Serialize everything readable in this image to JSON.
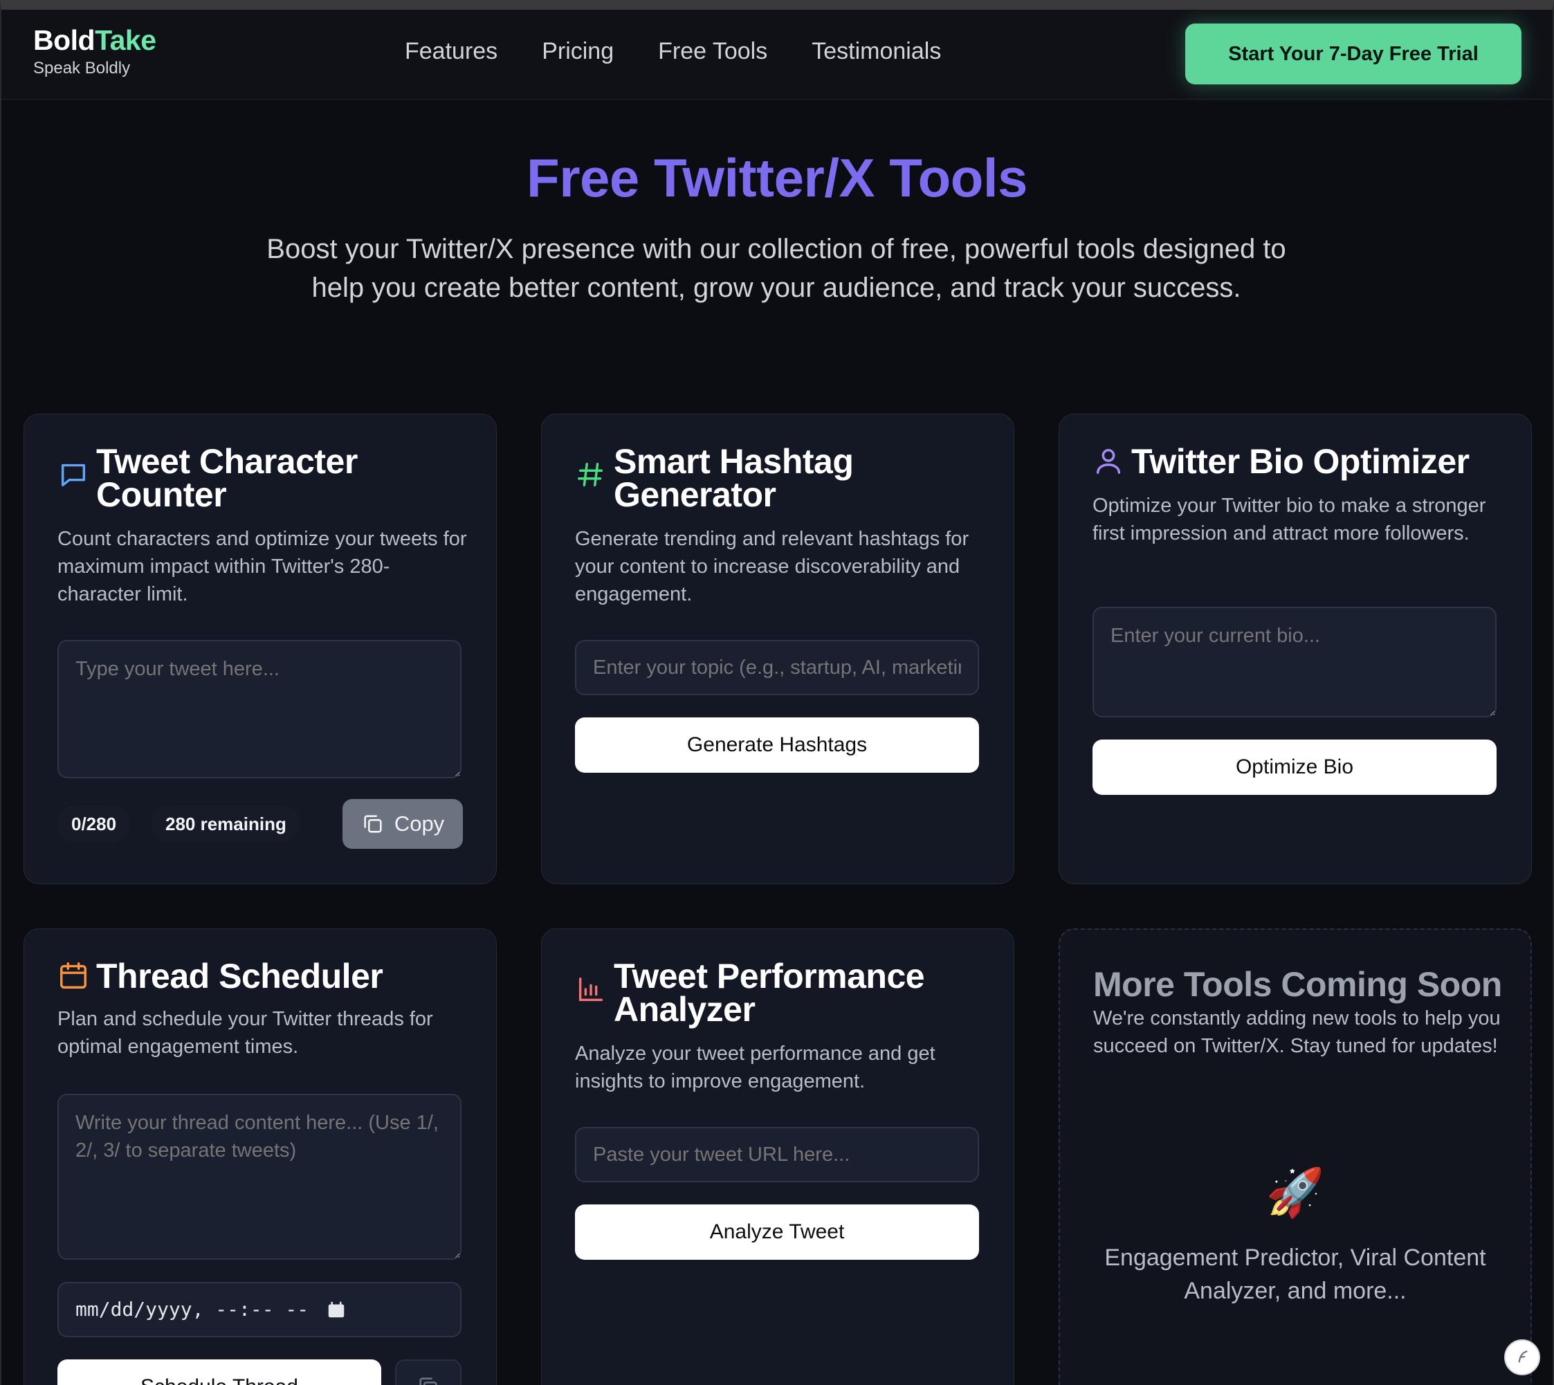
{
  "brand": {
    "name_part1": "Bold",
    "name_part2": "Take",
    "tagline": "Speak Boldly"
  },
  "nav": {
    "links": [
      "Features",
      "Pricing",
      "Free Tools",
      "Testimonials"
    ],
    "cta_label": "Start Your 7-Day Free Trial"
  },
  "hero": {
    "title": "Free Twitter/X Tools",
    "subtitle": "Boost your Twitter/X presence with our collection of free, powerful tools designed to help you create better content, grow your audience, and track your success."
  },
  "colors": {
    "accent_green": "#5fd699",
    "accent_purple": "#7c6cf0",
    "icon_blue": "#60a5fa",
    "icon_green": "#4ade80",
    "icon_violet": "#a78bfa",
    "icon_orange": "#fb923c",
    "icon_red": "#f87171",
    "card_bg": "#141824",
    "page_bg": "#0b0d13"
  },
  "tools": {
    "char_counter": {
      "icon": "message-icon",
      "title": "Tweet Character Counter",
      "description": "Count characters and optimize your tweets for maximum impact within Twitter's 280-character limit.",
      "placeholder": "Type your tweet here...",
      "count": "0/280",
      "remaining": "280 remaining",
      "copy_label": "Copy"
    },
    "hashtag": {
      "icon": "hash-icon",
      "title": "Smart Hashtag Generator",
      "description": "Generate trending and relevant hashtags for your content to increase discoverability and engagement.",
      "placeholder": "Enter your topic (e.g., startup, AI, marketing)",
      "button_label": "Generate Hashtags"
    },
    "bio": {
      "icon": "user-icon",
      "title": "Twitter Bio Optimizer",
      "description": "Optimize your Twitter bio to make a stronger first impression and attract more followers.",
      "placeholder": "Enter your current bio...",
      "button_label": "Optimize Bio"
    },
    "thread": {
      "icon": "calendar-icon",
      "title": "Thread Scheduler",
      "description": "Plan and schedule your Twitter threads for optimal engagement times.",
      "placeholder": "Write your thread content here... (Use 1/, 2/, 3/ to separate tweets)",
      "datetime_placeholder": "mm/dd/yyyy, --:-- --",
      "button_label": "Schedule Thread"
    },
    "performance": {
      "icon": "bar-chart-icon",
      "title": "Tweet Performance Analyzer",
      "description": "Analyze your tweet performance and get insights to improve engagement.",
      "placeholder": "Paste your tweet URL here...",
      "button_label": "Analyze Tweet"
    },
    "coming_soon": {
      "title": "More Tools Coming Soon",
      "description": "We're constantly adding new tools to help you succeed on Twitter/X. Stay tuned for updates!",
      "icon": "rocket-icon",
      "list": "Engagement Predictor, Viral Content Analyzer, and more..."
    }
  }
}
